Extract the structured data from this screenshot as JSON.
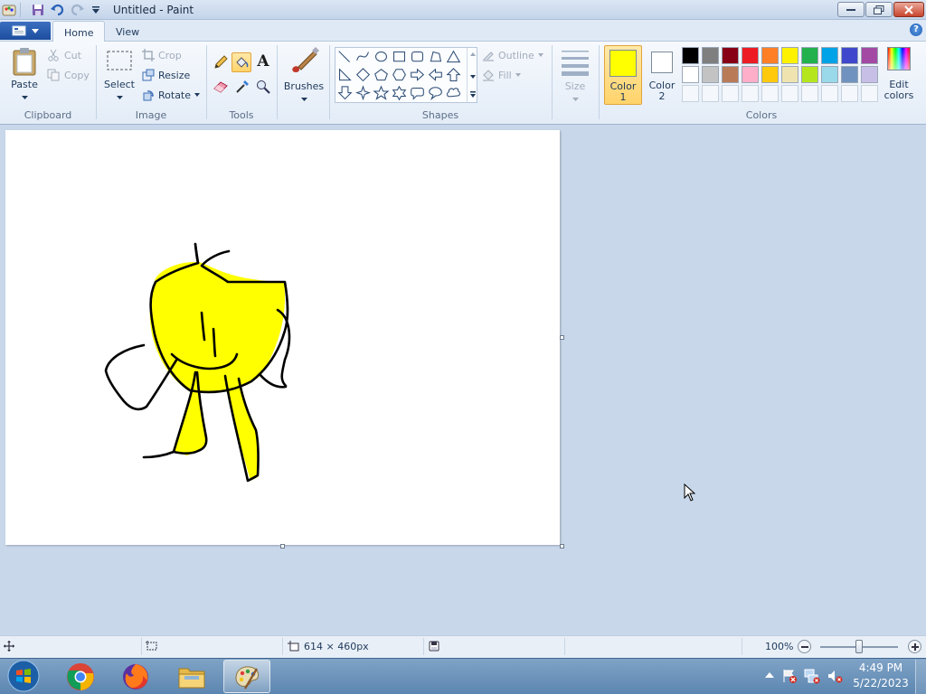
{
  "window": {
    "title": "Untitled - Paint"
  },
  "tabs": [
    {
      "label": "Home"
    },
    {
      "label": "View"
    }
  ],
  "clipboard": {
    "paste": "Paste",
    "cut": "Cut",
    "copy": "Copy",
    "group": "Clipboard"
  },
  "image": {
    "select": "Select",
    "crop": "Crop",
    "resize": "Resize",
    "rotate": "Rotate",
    "group": "Image"
  },
  "tools": {
    "group": "Tools",
    "text_tool": "A"
  },
  "brushes": {
    "label": "Brushes"
  },
  "shapes": {
    "outline": "Outline",
    "fill": "Fill",
    "group": "Shapes"
  },
  "size": {
    "label": "Size"
  },
  "color1": {
    "label": "Color",
    "num": "1",
    "value": "#ffff00"
  },
  "color2": {
    "label": "Color",
    "num": "2",
    "value": "#ffffff"
  },
  "colors": {
    "group": "Colors",
    "edit_line1": "Edit",
    "edit_line2": "colors",
    "palette_row1": [
      "#000000",
      "#7f7f7f",
      "#880015",
      "#ed1c24",
      "#ff7f27",
      "#fff200",
      "#22b14c",
      "#00a2e8",
      "#3f48cc",
      "#a349a4"
    ],
    "palette_row2": [
      "#ffffff",
      "#c3c3c3",
      "#b97a57",
      "#ffaec9",
      "#ffc90e",
      "#efe4b0",
      "#b5e61d",
      "#99d9ea",
      "#7092be",
      "#c8bfe7"
    ]
  },
  "status": {
    "dimensions": "614 × 460px",
    "zoom": "100%",
    "zoom_slider_fraction": 0.5
  },
  "taskbar": {
    "time": "4:49 PM",
    "date": "5/22/2023"
  },
  "drawing": {
    "fill_color": "#ffff00",
    "stroke_color": "#000000"
  }
}
